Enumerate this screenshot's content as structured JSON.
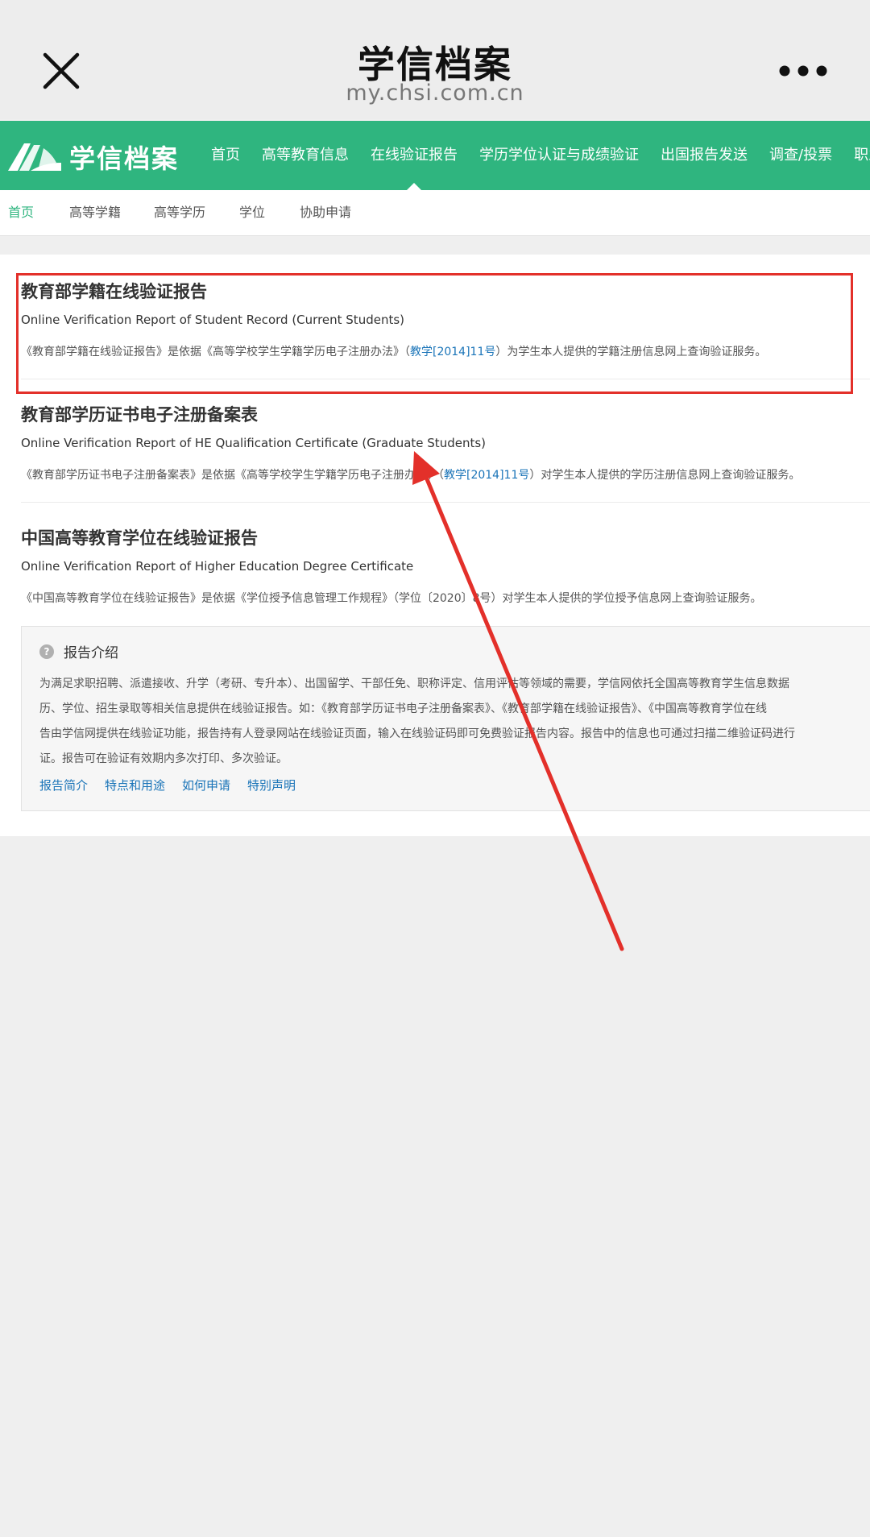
{
  "wechat": {
    "title": "学信档案",
    "url": "my.chsi.com.cn",
    "close_icon": "close-icon",
    "more_icon": "more-dots-icon"
  },
  "site_nav": {
    "logo_text": "学信档案",
    "items": [
      {
        "label": "首页"
      },
      {
        "label": "高等教育信息"
      },
      {
        "label": "在线验证报告",
        "active": true
      },
      {
        "label": "学历学位认证与成绩验证"
      },
      {
        "label": "出国报告发送"
      },
      {
        "label": "调查/投票"
      },
      {
        "label": "职业"
      }
    ]
  },
  "sub_nav": {
    "items": [
      {
        "label": "首页",
        "active": true
      },
      {
        "label": "高等学籍"
      },
      {
        "label": "高等学历"
      },
      {
        "label": "学位"
      },
      {
        "label": "协助申请"
      }
    ]
  },
  "reports": [
    {
      "title": "教育部学籍在线验证报告",
      "english": "Online Verification Report of Student Record (Current Students)",
      "desc_before": "《教育部学籍在线验证报告》是依据《高等学校学生学籍学历电子注册办法》（",
      "desc_link": "教学[2014]11号",
      "desc_after": "）为学生本人提供的学籍注册信息网上查询验证服务。"
    },
    {
      "title": "教育部学历证书电子注册备案表",
      "english": "Online Verification Report of HE Qualification Certificate (Graduate Students)",
      "desc_before": "《教育部学历证书电子注册备案表》是依据《高等学校学生学籍学历电子注册办法》（",
      "desc_link": "教学[2014]11号",
      "desc_after": "）对学生本人提供的学历注册信息网上查询验证服务。"
    },
    {
      "title": "中国高等教育学位在线验证报告",
      "english": "Online Verification Report of Higher Education Degree Certificate",
      "desc_before": "《中国高等教育学位在线验证报告》是依据《学位授予信息管理工作规程》（学位〔2020〕8号）对学生本人提供的学位授予信息网上查询验证服务。",
      "desc_link": "",
      "desc_after": ""
    }
  ],
  "intro": {
    "title": "报告介绍",
    "lines": [
      "为满足求职招聘、派遣接收、升学（考研、专升本）、出国留学、干部任免、职称评定、信用评估等领域的需要，学信网依托全国高等教育学生信息数据",
      "历、学位、招生录取等相关信息提供在线验证报告。如：《教育部学历证书电子注册备案表》、《教育部学籍在线验证报告》、《中国高等教育学位在线",
      "告由学信网提供在线验证功能，报告持有人登录网站在线验证页面，输入在线验证码即可免费验证报告内容。报告中的信息也可通过扫描二维验证码进行",
      "证。报告可在验证有效期内多次打印、多次验证。"
    ],
    "links": [
      "报告简介",
      "特点和用途",
      "如何申请",
      "特别声明"
    ]
  },
  "annotation": {
    "highlight_color": "#e3302a"
  },
  "colors": {
    "brand_green": "#2fb57f",
    "link_blue": "#1a74b8"
  }
}
